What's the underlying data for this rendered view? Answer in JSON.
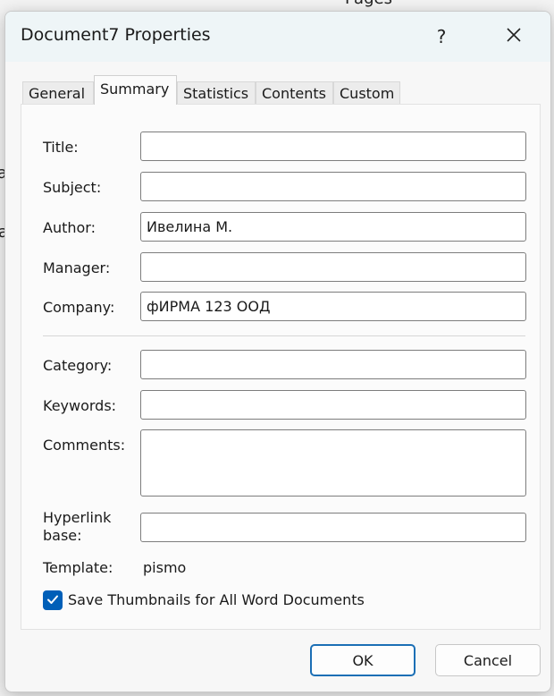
{
  "background": {
    "top_text": "Pages",
    "left_text_1": "ar",
    "left_text_2": "a"
  },
  "dialog": {
    "title": "Document7 Properties",
    "help_label": "?",
    "close_label": "✕"
  },
  "tabs": [
    {
      "label": "General",
      "active": false
    },
    {
      "label": "Summary",
      "active": true
    },
    {
      "label": "Statistics",
      "active": false
    },
    {
      "label": "Contents",
      "active": false
    },
    {
      "label": "Custom",
      "active": false
    }
  ],
  "form": {
    "title_label": "Title:",
    "title_value": "",
    "subject_label": "Subject:",
    "subject_value": "",
    "author_label": "Author:",
    "author_value": "Ивелина М.",
    "manager_label": "Manager:",
    "manager_value": "",
    "company_label": "Company:",
    "company_value": "фИРМА 123 ООД",
    "category_label": "Category:",
    "category_value": "",
    "keywords_label": "Keywords:",
    "keywords_value": "",
    "comments_label": "Comments:",
    "comments_value": "",
    "hyperlink_label_line1": "Hyperlink",
    "hyperlink_label_line2": "base:",
    "hyperlink_value": "",
    "template_label": "Template:",
    "template_value": "pismo",
    "thumbnail_label": "Save Thumbnails for All Word Documents",
    "thumbnail_checked": true
  },
  "buttons": {
    "ok": "OK",
    "cancel": "Cancel"
  },
  "colors": {
    "accent": "#005fb8",
    "titlebar": "#eef5f7"
  }
}
